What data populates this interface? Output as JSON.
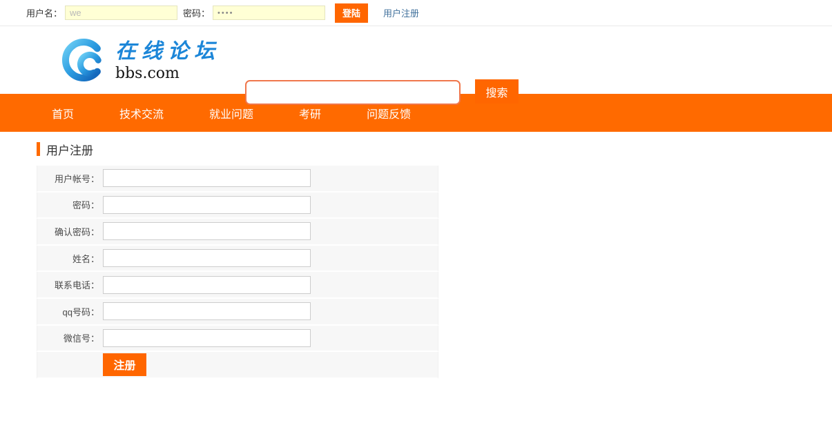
{
  "topbar": {
    "username_label": "用户名：",
    "username_value": "we",
    "password_label": "密码：",
    "password_value": "••••",
    "login_button": "登陆",
    "register_link": "用户注册"
  },
  "header": {
    "logo": {
      "title": "在线论坛",
      "domain": "bbs.com"
    },
    "search": {
      "value": "",
      "button": "搜索"
    }
  },
  "nav": {
    "items": [
      "首页",
      "技术交流",
      "就业问题",
      "考研",
      "问题反馈"
    ]
  },
  "main": {
    "section_title": "用户注册",
    "form": {
      "row_labels": [
        "用户帐号：",
        "密码：",
        "确认密码：",
        "姓名：",
        "联系电话：",
        "qq号码：",
        "微信号："
      ],
      "submit_button": "注册"
    }
  },
  "colors": {
    "accent_orange": "#ff6a00",
    "button_orange": "#ff6600",
    "link_blue": "#41719c",
    "search_border_orange": "#f0764b",
    "topbar_input_yellow": "#ffffd5",
    "logo_blue": "#1c86d8",
    "form_row_gray": "#f7f7f7"
  }
}
